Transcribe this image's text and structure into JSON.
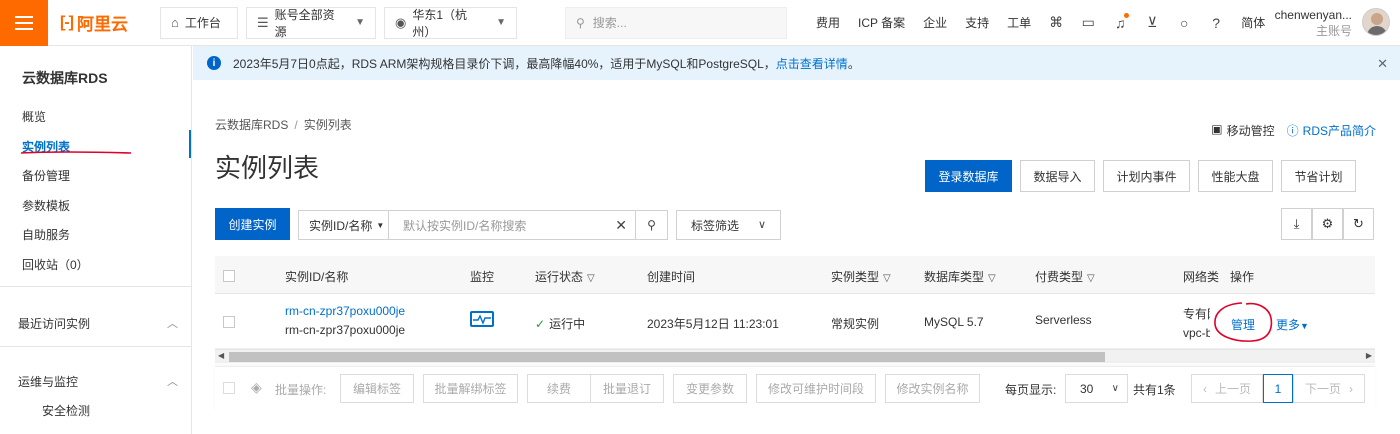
{
  "topbar": {
    "logo_text": "阿里云",
    "workbench": "工作台",
    "resources": "账号全部资源",
    "region": "华东1（杭州）",
    "search_placeholder": "搜索...",
    "nav": [
      "费用",
      "ICP 备案",
      "企业",
      "支持",
      "工单"
    ],
    "lang": "简体",
    "username": "chenwenyan...",
    "account_type": "主账号"
  },
  "sidebar": {
    "title": "云数据库RDS",
    "items": [
      "概览",
      "实例列表",
      "备份管理",
      "参数模板",
      "自助服务",
      "回收站（0）"
    ],
    "groups": [
      "最近访问实例",
      "运维与监控"
    ],
    "subitem": "安全检测"
  },
  "notice": {
    "text": "2023年5月7日0点起，RDS ARM架构规格目录价下调，最高降幅40%，适用于MySQL和PostgreSQL，",
    "link": "点击查看详情",
    "tail": "。"
  },
  "breadcrumb": [
    "云数据库RDS",
    "实例列表"
  ],
  "toplinks": {
    "mobile": "移动管控",
    "intro": "RDS产品简介"
  },
  "page_title": "实例列表",
  "actions": [
    "登录数据库",
    "数据导入",
    "计划内事件",
    "性能大盘",
    "节省计划"
  ],
  "toolbar": {
    "create": "创建实例",
    "filter_field": "实例ID/名称",
    "search_placeholder": "默认按实例ID/名称搜索",
    "tag_filter": "标签筛选"
  },
  "table": {
    "headers": [
      "实例ID/名称",
      "监控",
      "运行状态",
      "创建时间",
      "实例类型",
      "数据库类型",
      "付费类型",
      "网络类",
      "操作"
    ],
    "row": {
      "id": "rm-cn-zpr37poxu000je",
      "name": "rm-cn-zpr37poxu000je",
      "status": "运行中",
      "created": "2023年5月12日 11:23:01",
      "instance_type": "常规实例",
      "db_type": "MySQL 5.7",
      "pay_type": "Serverless",
      "network_1": "专有网",
      "network_2": "vpc-b",
      "manage": "管理",
      "more": "更多"
    }
  },
  "footer": {
    "batch_label": "批量操作:",
    "buttons": [
      "编辑标签",
      "批量解绑标签",
      "续费",
      "批量退订",
      "变更参数",
      "修改可维护时间段",
      "修改实例名称"
    ],
    "per_page_label": "每页显示:",
    "per_page": "30",
    "total": "共有1条",
    "prev": "上一页",
    "page": "1",
    "next": "下一页"
  },
  "colors": {
    "brand": "#ff6a00",
    "primary": "#0064c8",
    "link": "#0070cc",
    "annotation": "#e0002a"
  }
}
